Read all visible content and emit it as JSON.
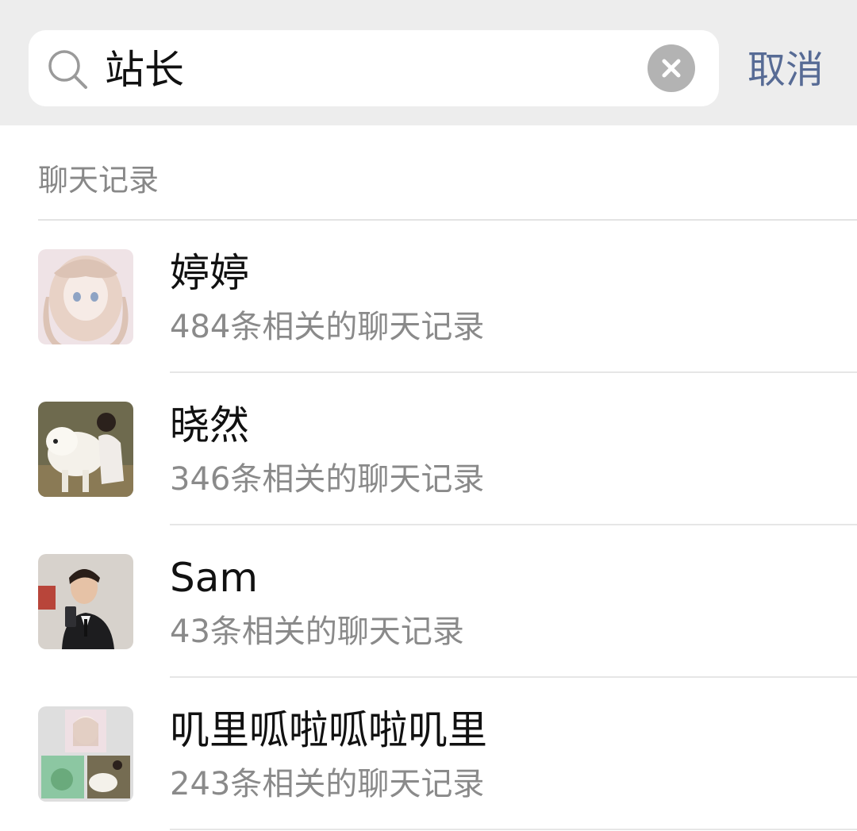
{
  "search": {
    "query": "站长",
    "clear_icon": "clear-icon",
    "search_icon": "search-icon",
    "cancel_label": "取消"
  },
  "section": {
    "title": "聊天记录"
  },
  "results": [
    {
      "name": "婷婷",
      "summary": "484条相关的聊天记录",
      "avatar": "anime-girl-avatar"
    },
    {
      "name": "晓然",
      "summary": "346条相关的聊天记录",
      "avatar": "dog-and-woman-avatar"
    },
    {
      "name": "Sam",
      "summary": "43条相关的聊天记录",
      "avatar": "man-in-suit-avatar"
    },
    {
      "name": "叽里呱啦呱啦叽里",
      "summary": "243条相关的聊天记录",
      "avatar": "group-avatar"
    }
  ],
  "colors": {
    "accent": "#576b95",
    "topbar_bg": "#ededed",
    "secondary_text": "#8a8a8a"
  }
}
